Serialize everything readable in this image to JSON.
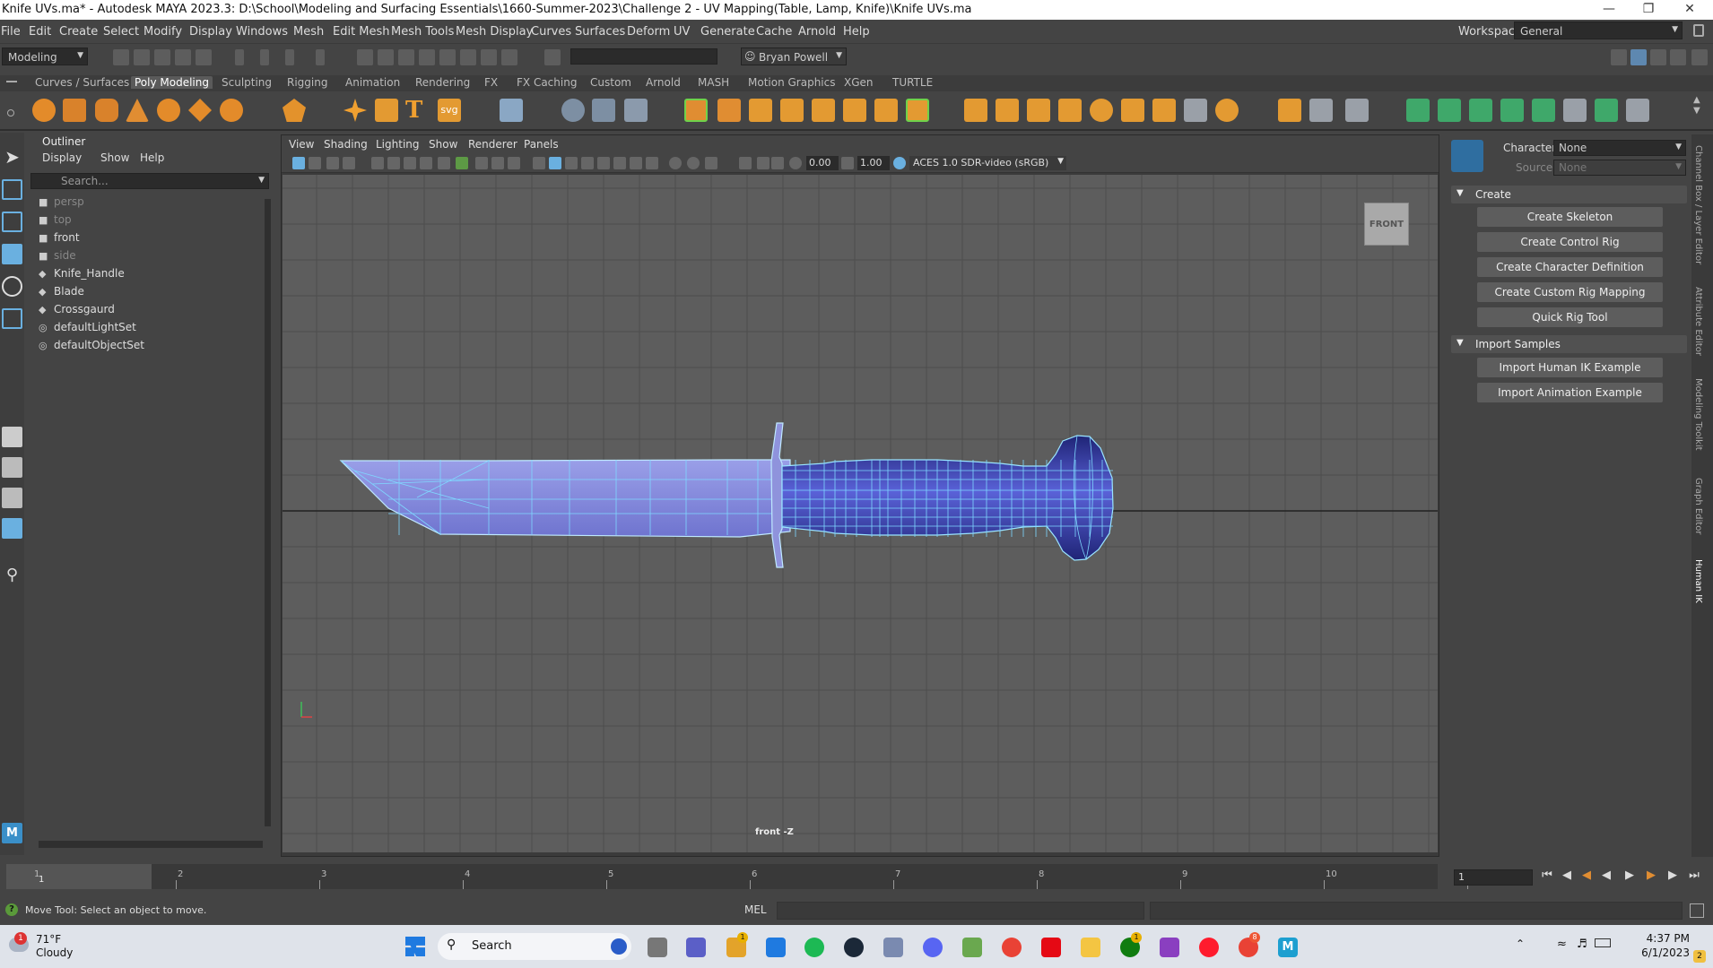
{
  "window": {
    "title": "Knife UVs.ma* - Autodesk MAYA 2023.3: D:\\School\\Modeling and Surfacing Essentials\\1660-Summer-2023\\Challenge 2 - UV Mapping(Table, Lamp, Knife)\\Knife UVs.ma"
  },
  "menubar": {
    "items": [
      "File",
      "Edit",
      "Create",
      "Select",
      "Modify",
      "Display",
      "Windows",
      "Mesh",
      "Edit Mesh",
      "Mesh Tools",
      "Mesh Display",
      "Curves",
      "Surfaces",
      "Deform",
      "UV",
      "Generate",
      "Cache",
      "Arnold",
      "Help"
    ],
    "workspace_label": "Workspace:",
    "workspace_value": "General"
  },
  "statusline": {
    "mode": "Modeling",
    "user": "Bryan Powell"
  },
  "shelf": {
    "tabs": [
      "Curves / Surfaces",
      "Poly Modeling",
      "Sculpting",
      "Rigging",
      "Animation",
      "Rendering",
      "FX",
      "FX Caching",
      "Custom",
      "Arnold",
      "MASH",
      "Motion Graphics",
      "XGen",
      "TURTLE"
    ],
    "active": "Poly Modeling",
    "svg_label": "svg"
  },
  "outliner": {
    "title": "Outliner",
    "menu": [
      "Display",
      "Show",
      "Help"
    ],
    "search_placeholder": "Search...",
    "items": [
      {
        "label": "persp",
        "icon": "camera-icon",
        "dim": true
      },
      {
        "label": "top",
        "icon": "camera-icon",
        "dim": true
      },
      {
        "label": "front",
        "icon": "camera-icon",
        "dim": false
      },
      {
        "label": "side",
        "icon": "camera-icon",
        "dim": true
      },
      {
        "label": "Knife_Handle",
        "icon": "mesh-icon",
        "dim": false
      },
      {
        "label": "Blade",
        "icon": "mesh-icon",
        "dim": false
      },
      {
        "label": "Crossgaurd",
        "icon": "mesh-icon",
        "dim": false
      },
      {
        "label": "defaultLightSet",
        "icon": "set-icon",
        "dim": false
      },
      {
        "label": "defaultObjectSet",
        "icon": "set-icon",
        "dim": false
      }
    ]
  },
  "viewport": {
    "menu": [
      "View",
      "Shading",
      "Lighting",
      "Show",
      "Renderer",
      "Panels"
    ],
    "near": "0.00",
    "far": "1.00",
    "colorspace": "ACES 1.0 SDR-video (sRGB)",
    "camera_label": "front -Z",
    "viewcube": "FRONT"
  },
  "humanik": {
    "character_label": "Character:",
    "character_value": "None",
    "source_label": "Source:",
    "source_value": "None",
    "sections": [
      {
        "title": "Create",
        "buttons": [
          "Create Skeleton",
          "Create Control Rig",
          "Create Character Definition",
          "Create Custom Rig Mapping",
          "Quick Rig Tool"
        ]
      },
      {
        "title": "Import Samples",
        "buttons": [
          "Import Human IK Example",
          "Import Animation Example"
        ]
      }
    ]
  },
  "side_tabs": [
    "Channel Box / Layer Editor",
    "Attribute Editor",
    "Modeling Toolkit",
    "Graph Editor",
    "Human IK"
  ],
  "timeline": {
    "ticks": [
      "1",
      "2",
      "3",
      "4",
      "5",
      "6",
      "7",
      "8",
      "9",
      "10"
    ],
    "current_frame": "1",
    "frame_field": "1"
  },
  "commandline": {
    "lang": "MEL",
    "help": "Move Tool: Select an object to move."
  },
  "taskbar": {
    "weather_temp": "71°F",
    "weather_text": "Cloudy",
    "weather_badge": "1",
    "search": "Search",
    "time": "4:37 PM",
    "date": "6/1/2023",
    "mail_badge": "1",
    "xbox_badge": "1",
    "chrome_badge": "8",
    "notif": "2"
  },
  "colors": {
    "mesh_fill": "#2a2f9a",
    "wire": "#7fd8ff",
    "blade_fill": "#7e82d6",
    "bg": "#5d5d5d"
  }
}
